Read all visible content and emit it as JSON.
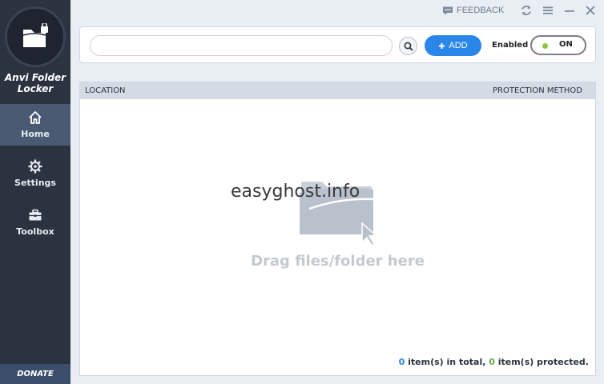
{
  "app": {
    "name": "Anvi Folder Locker",
    "name_line1": "Anvi Folder",
    "name_line2": "Locker"
  },
  "sidebar": {
    "items": [
      {
        "label": "Home",
        "icon": "home-icon",
        "active": true
      },
      {
        "label": "Settings",
        "icon": "gear-icon",
        "active": false
      },
      {
        "label": "Toolbox",
        "icon": "toolbox-icon",
        "active": false
      }
    ],
    "donate_label": "DONATE"
  },
  "titlebar": {
    "feedback_label": "FEEDBACK",
    "icons": [
      "feedback-icon",
      "refresh-icon",
      "menu-icon",
      "minimize-icon",
      "close-icon"
    ]
  },
  "toolbar": {
    "search_value": "",
    "search_placeholder": "",
    "add_label": "ADD",
    "enabled_label": "Enabled",
    "toggle_state": "ON"
  },
  "list": {
    "columns": [
      "LOCATION",
      "PROTECTION METHOD"
    ],
    "watermark": "easyghost.info",
    "drop_hint": "Drag files/folder here",
    "status": {
      "total_count": "0",
      "total_text": " item(s) in total, ",
      "protected_count": "0",
      "protected_text": " item(s) protected."
    }
  },
  "colors": {
    "sidebar_bg": "#2b3240",
    "sidebar_active": "#4a5a73",
    "accent_blue": "#2a86e8",
    "toggle_dot_green": "#8cc63f"
  }
}
